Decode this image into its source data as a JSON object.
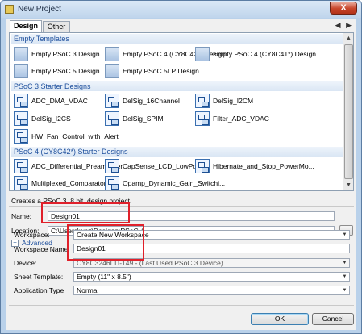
{
  "window": {
    "title": "New Project",
    "close_label": "X"
  },
  "tabs": [
    {
      "label": "Design"
    },
    {
      "label": "Other"
    }
  ],
  "pager": "◀ ▶",
  "gallery": {
    "groups": [
      {
        "title": "Empty Templates",
        "items": [
          {
            "label": "Empty PSoC 3 Design",
            "icon": "blank-template-icon"
          },
          {
            "label": "Empty PSoC 4 (CY8C42*) Design",
            "icon": "blank-template-icon"
          },
          {
            "label": "Empty PSoC 4 (CY8C41*) Design",
            "icon": "blank-template-icon"
          },
          {
            "label": "Empty PSoC 5 Design",
            "icon": "blank-template-icon"
          },
          {
            "label": "Empty PSoC 5LP Design",
            "icon": "blank-template-icon"
          }
        ]
      },
      {
        "title": "PSoC 3 Starter Designs",
        "items": [
          {
            "label": "ADC_DMA_VDAC",
            "icon": "starter-design-icon"
          },
          {
            "label": "DelSig_16Channel",
            "icon": "starter-design-icon"
          },
          {
            "label": "DelSig_I2CM",
            "icon": "starter-design-icon"
          },
          {
            "label": "DelSig_I2CS",
            "icon": "starter-design-icon"
          },
          {
            "label": "DelSig_SPIM",
            "icon": "starter-design-icon"
          },
          {
            "label": "Filter_ADC_VDAC",
            "icon": "starter-design-icon"
          },
          {
            "label": "HW_Fan_Control_with_Alert",
            "icon": "starter-design-icon"
          }
        ]
      },
      {
        "title": "PSoC 4 (CY8C42*) Starter Designs",
        "items": [
          {
            "label": "ADC_Differential_Preamplifier",
            "icon": "starter-design-icon"
          },
          {
            "label": "CapSense_LCD_LowPower",
            "icon": "starter-design-icon"
          },
          {
            "label": "Hibernate_and_Stop_PowerMo...",
            "icon": "starter-design-icon"
          },
          {
            "label": "Multiplexed_Comparator",
            "icon": "starter-design-icon"
          },
          {
            "label": "Opamp_Dynamic_Gain_Switchi...",
            "icon": "starter-design-icon"
          }
        ]
      }
    ]
  },
  "description": "Creates a PSoC 3, 8 bit, design project.",
  "form": {
    "name_label": "Name:",
    "name_value": "Design01",
    "location_label": "Location:",
    "location_value": "C:\\Users\\wbz\\Desktop\\PSoC 4",
    "browse_label": "...",
    "advanced_toggle": "−",
    "advanced_label": "Advanced",
    "workspace_label": "Workspace:",
    "workspace_value": "Create New Workspace",
    "workspace_name_label": "Workspace Name:",
    "workspace_name_value": "Design01",
    "device_label": "Device:",
    "device_value": "CY8C3246LTI-149 - (Last Used PSoC 3 Device)",
    "sheet_label": "Sheet Template:",
    "sheet_value": "Empty (11\" x 8.5\")",
    "apptype_label": "Application Type",
    "apptype_value": "Normal"
  },
  "buttons": {
    "ok": "OK",
    "cancel": "Cancel"
  },
  "colors": {
    "highlight_box": "#e0202a",
    "group_header_text": "#1c4e9c"
  }
}
